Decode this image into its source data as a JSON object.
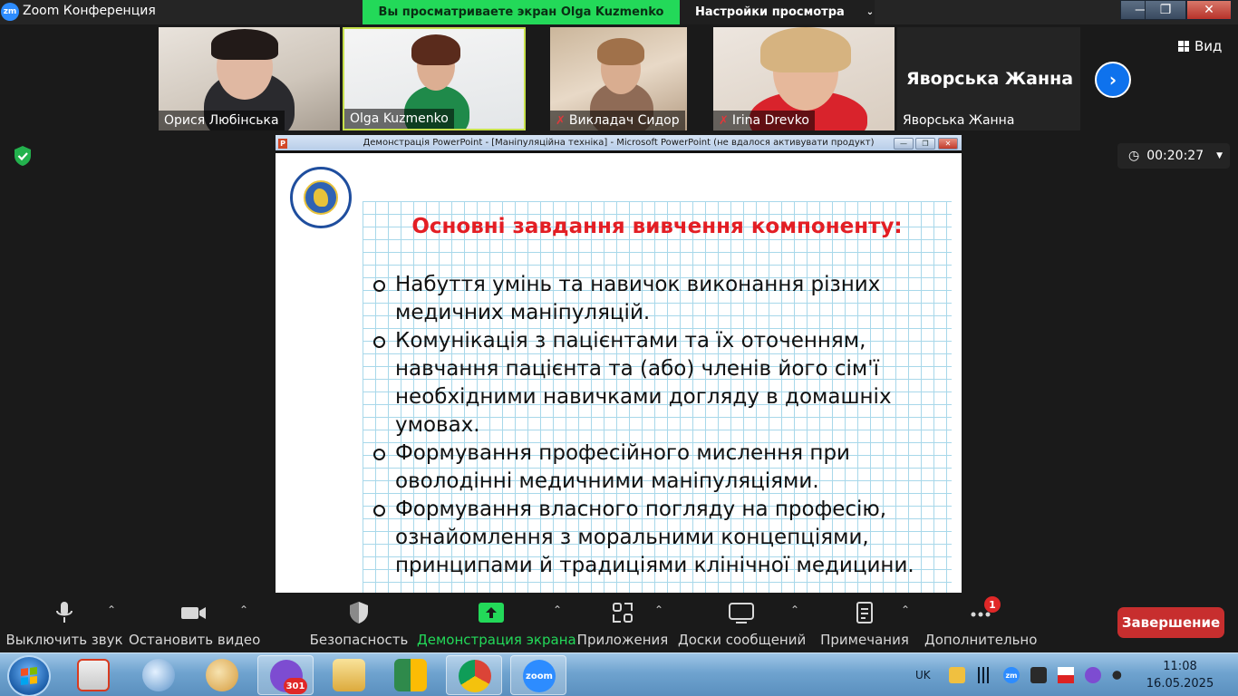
{
  "window": {
    "app_logo": "zm",
    "title": "Zoom Конференция",
    "share_banner": "Вы просматриваете экран Olga Kuzmenko",
    "view_settings": "Настройки просмотра",
    "minimize": "—",
    "restore": "❐",
    "close": "✕"
  },
  "gallery": {
    "participants": [
      {
        "name": "Орися Любінська",
        "muted": false
      },
      {
        "name": "Olga Kuzmenko",
        "muted": false
      },
      {
        "name": "Викладач Сидор",
        "muted": true
      },
      {
        "name": "Irina Drevko",
        "muted": true
      },
      {
        "name": "Яворська Жанна",
        "muted": false
      }
    ],
    "big_name": "Яворська Жанна",
    "view_label": "Вид",
    "next_icon": "chevron-right-icon"
  },
  "timer": "00:20:27",
  "ppt": {
    "icon": "P",
    "title": "Демонстрація PowerPoint - [Маніпуляційна техніка] - Microsoft PowerPoint (не вдалося активувати продукт)",
    "slide_title": "Основні завдання вивчення компоненту:",
    "bullets": [
      "Набуття умінь та навичок виконання різних медичних маніпуляцій.",
      "Комунікація з пацієнтами та їх оточенням, навчання пацієнта та (або) членів його сім'ї необхідними навичками догляду в домашніх умовах.",
      "Формування професійного мислення при оволодінні медичними маніпуляціями.",
      "Формування власного погляду на професію, ознайомлення з моральними концепціями, принципами й традиціями клінічної медицини."
    ]
  },
  "toolbar": {
    "mute": "Выключить звук",
    "video": "Остановить видео",
    "security": "Безопасность",
    "share": "Демонстрация экрана",
    "apps": "Приложения",
    "whiteboards": "Доски сообщений",
    "notes": "Примечания",
    "more": "Дополнительно",
    "more_badge": "1",
    "end": "Завершение"
  },
  "taskbar": {
    "viber_badge": "301",
    "zoom_label": "zoom",
    "lang": "UK",
    "tray_zm": "zm",
    "time": "11:08",
    "date": "16.05.2025"
  },
  "colors": {
    "share_green": "#23d959",
    "zoom_blue": "#0e72ed",
    "end_red": "#c72e2e",
    "slide_title_red": "#e31e24"
  }
}
